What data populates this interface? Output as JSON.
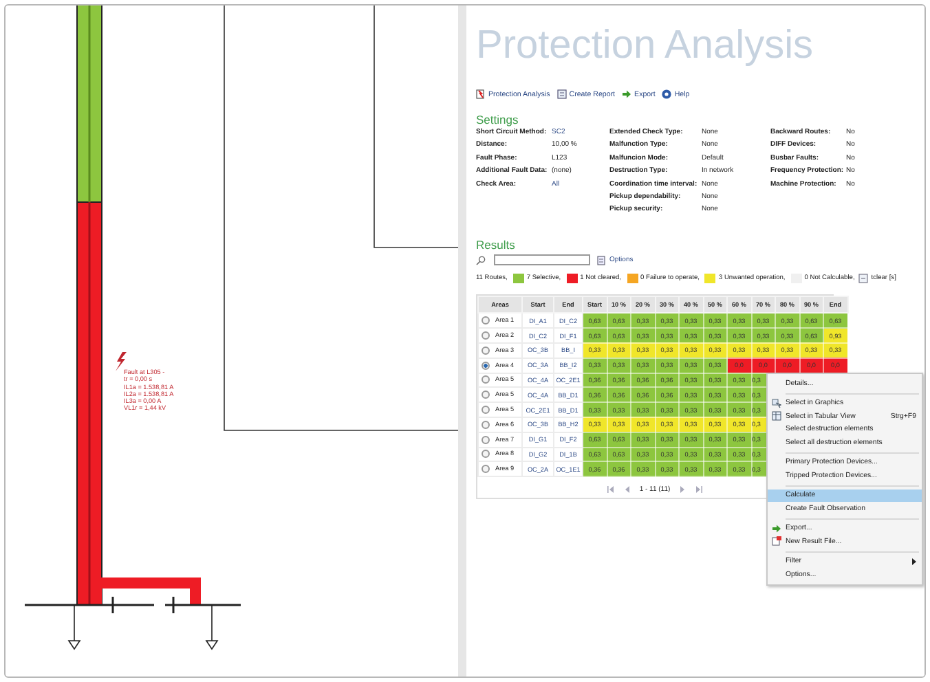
{
  "diagram": {
    "fault_label": [
      "Fault at L305 -",
      "tr = 0,00 s",
      "IL1a = 1.538,81 A",
      "IL2a = 1.538,81 A",
      "IL3a = 0,00 A",
      "VL1r = 1,44 kV"
    ]
  },
  "panel": {
    "title": "Protection Analysis",
    "toolbar": [
      {
        "label": "Protection Analysis",
        "kind": "analysis"
      },
      {
        "label": "Create Report",
        "kind": "report"
      },
      {
        "label": "Export",
        "kind": "export"
      },
      {
        "label": "Help",
        "kind": "help"
      }
    ],
    "settings_heading": "Settings",
    "settings": [
      [
        {
          "label": "Short Circuit Method:",
          "value": "SC2",
          "link": true
        },
        {
          "label": "Distance:",
          "value": "10,00 %",
          "link": false
        },
        {
          "label": "Fault Phase:",
          "value": "L123",
          "link": false
        },
        {
          "label": "Additional Fault Data:",
          "value": "(none)",
          "link": false
        },
        {
          "label": "Check Area:",
          "value": "All",
          "link": true
        }
      ],
      [
        {
          "label": "Extended Check Type:",
          "value": "None",
          "link": false
        },
        {
          "label": "Malfunction Type:",
          "value": "None",
          "link": false
        },
        {
          "label": "Malfuncion Mode:",
          "value": "Default",
          "link": false
        },
        {
          "label": "Destruction Type:",
          "value": "In network",
          "link": false
        },
        {
          "label": "Coordination time interval:",
          "value": "None",
          "link": false
        },
        {
          "label": "Pickup dependability:",
          "value": "None",
          "link": false
        },
        {
          "label": "Pickup security:",
          "value": "None",
          "link": false
        }
      ],
      [
        {
          "label": "Backward Routes:",
          "value": "No",
          "link": false
        },
        {
          "label": "DIFF Devices:",
          "value": "No",
          "link": false
        },
        {
          "label": "Busbar Faults:",
          "value": "No",
          "link": false
        },
        {
          "label": "Frequency Protection:",
          "value": "No",
          "link": false
        },
        {
          "label": "Machine Protection:",
          "value": "No",
          "link": false
        }
      ]
    ],
    "results_heading": "Results",
    "options_link": "Options",
    "legend": [
      {
        "text": "11 Routes,",
        "kind": "none"
      },
      {
        "text": "7 Selective,",
        "kind": "selective"
      },
      {
        "text": "1 Not cleared,",
        "kind": "notcleared"
      },
      {
        "text": "0 Failure to operate,",
        "kind": "failure"
      },
      {
        "text": "3 Unwanted operation,",
        "kind": "unwanted"
      },
      {
        "text": "0 Not Calculable,",
        "kind": "notcalc"
      },
      {
        "text": "tclear [s]",
        "kind": "tclear"
      }
    ],
    "table": {
      "columns": [
        "Areas",
        "Start",
        "End",
        "Start",
        "10 %",
        "20 %",
        "30 %",
        "40 %",
        "50 %",
        "60 %",
        "70 %",
        "80 %",
        "90 %",
        "End"
      ],
      "rows": [
        {
          "selected": false,
          "cells": [
            {
              "value": "Area 1",
              "kind": "area"
            },
            {
              "value": "DI_A1",
              "kind": "link"
            },
            {
              "value": "DI_C2",
              "kind": "link"
            },
            {
              "value": "0,63",
              "kind": "selective"
            },
            {
              "value": "0,63",
              "kind": "selective"
            },
            {
              "value": "0,33",
              "kind": "selective"
            },
            {
              "value": "0,33",
              "kind": "selective"
            },
            {
              "value": "0,33",
              "kind": "selective"
            },
            {
              "value": "0,33",
              "kind": "selective"
            },
            {
              "value": "0,33",
              "kind": "selective"
            },
            {
              "value": "0,33",
              "kind": "selective"
            },
            {
              "value": "0,33",
              "kind": "selective"
            },
            {
              "value": "0,63",
              "kind": "selective"
            },
            {
              "value": "0,63",
              "kind": "selective"
            }
          ]
        },
        {
          "selected": false,
          "cells": [
            {
              "value": "Area 2",
              "kind": "area"
            },
            {
              "value": "DI_C2",
              "kind": "link"
            },
            {
              "value": "DI_F1",
              "kind": "link"
            },
            {
              "value": "0,63",
              "kind": "selective"
            },
            {
              "value": "0,63",
              "kind": "selective"
            },
            {
              "value": "0,33",
              "kind": "selective"
            },
            {
              "value": "0,33",
              "kind": "selective"
            },
            {
              "value": "0,33",
              "kind": "selective"
            },
            {
              "value": "0,33",
              "kind": "selective"
            },
            {
              "value": "0,33",
              "kind": "selective"
            },
            {
              "value": "0,33",
              "kind": "selective"
            },
            {
              "value": "0,33",
              "kind": "selective"
            },
            {
              "value": "0,63",
              "kind": "selective"
            },
            {
              "value": "0,93",
              "kind": "unwanted"
            }
          ]
        },
        {
          "selected": false,
          "cells": [
            {
              "value": "Area 3",
              "kind": "area"
            },
            {
              "value": "OC_3B",
              "kind": "link"
            },
            {
              "value": "BB_I",
              "kind": "link"
            },
            {
              "value": "0,33",
              "kind": "unwanted"
            },
            {
              "value": "0,33",
              "kind": "unwanted"
            },
            {
              "value": "0,33",
              "kind": "unwanted"
            },
            {
              "value": "0,33",
              "kind": "unwanted"
            },
            {
              "value": "0,33",
              "kind": "unwanted"
            },
            {
              "value": "0,33",
              "kind": "unwanted"
            },
            {
              "value": "0,33",
              "kind": "unwanted"
            },
            {
              "value": "0,33",
              "kind": "unwanted"
            },
            {
              "value": "0,33",
              "kind": "unwanted"
            },
            {
              "value": "0,33",
              "kind": "unwanted"
            },
            {
              "value": "0,33",
              "kind": "unwanted"
            }
          ]
        },
        {
          "selected": true,
          "cells": [
            {
              "value": "Area 4",
              "kind": "area"
            },
            {
              "value": "OC_3A",
              "kind": "link"
            },
            {
              "value": "BB_I2",
              "kind": "link"
            },
            {
              "value": "0,33",
              "kind": "selective"
            },
            {
              "value": "0,33",
              "kind": "selective"
            },
            {
              "value": "0,33",
              "kind": "selective"
            },
            {
              "value": "0,33",
              "kind": "selective"
            },
            {
              "value": "0,33",
              "kind": "selective"
            },
            {
              "value": "0,33",
              "kind": "selective"
            },
            {
              "value": "0,0",
              "kind": "notcleared"
            },
            {
              "value": "0,0",
              "kind": "notcleared"
            },
            {
              "value": "0,0",
              "kind": "notcleared"
            },
            {
              "value": "0,0",
              "kind": "notcleared"
            },
            {
              "value": "0,0",
              "kind": "notcleared"
            }
          ]
        },
        {
          "selected": false,
          "cells": [
            {
              "value": "Area 5",
              "kind": "area"
            },
            {
              "value": "OC_4A",
              "kind": "link"
            },
            {
              "value": "OC_2E1",
              "kind": "link"
            },
            {
              "value": "0,36",
              "kind": "selective"
            },
            {
              "value": "0,36",
              "kind": "selective"
            },
            {
              "value": "0,36",
              "kind": "selective"
            },
            {
              "value": "0,36",
              "kind": "selective"
            },
            {
              "value": "0,33",
              "kind": "selective"
            },
            {
              "value": "0,33",
              "kind": "selective"
            },
            {
              "value": "0,33",
              "kind": "selective"
            },
            {
              "value": "0,3",
              "kind": "selective"
            }
          ]
        },
        {
          "selected": false,
          "cells": [
            {
              "value": "Area 5",
              "kind": "area"
            },
            {
              "value": "OC_4A",
              "kind": "link"
            },
            {
              "value": "BB_D1",
              "kind": "link"
            },
            {
              "value": "0,36",
              "kind": "selective"
            },
            {
              "value": "0,36",
              "kind": "selective"
            },
            {
              "value": "0,36",
              "kind": "selective"
            },
            {
              "value": "0,36",
              "kind": "selective"
            },
            {
              "value": "0,33",
              "kind": "selective"
            },
            {
              "value": "0,33",
              "kind": "selective"
            },
            {
              "value": "0,33",
              "kind": "selective"
            },
            {
              "value": "0,3",
              "kind": "selective"
            }
          ]
        },
        {
          "selected": false,
          "cells": [
            {
              "value": "Area 5",
              "kind": "area"
            },
            {
              "value": "OC_2E1",
              "kind": "link"
            },
            {
              "value": "BB_D1",
              "kind": "link"
            },
            {
              "value": "0,33",
              "kind": "selective"
            },
            {
              "value": "0,33",
              "kind": "selective"
            },
            {
              "value": "0,33",
              "kind": "selective"
            },
            {
              "value": "0,33",
              "kind": "selective"
            },
            {
              "value": "0,33",
              "kind": "selective"
            },
            {
              "value": "0,33",
              "kind": "selective"
            },
            {
              "value": "0,33",
              "kind": "selective"
            },
            {
              "value": "0,3",
              "kind": "selective"
            }
          ]
        },
        {
          "selected": false,
          "cells": [
            {
              "value": "Area 6",
              "kind": "area"
            },
            {
              "value": "OC_3B",
              "kind": "link"
            },
            {
              "value": "BB_H2",
              "kind": "link"
            },
            {
              "value": "0,33",
              "kind": "unwanted"
            },
            {
              "value": "0,33",
              "kind": "unwanted"
            },
            {
              "value": "0,33",
              "kind": "unwanted"
            },
            {
              "value": "0,33",
              "kind": "unwanted"
            },
            {
              "value": "0,33",
              "kind": "unwanted"
            },
            {
              "value": "0,33",
              "kind": "unwanted"
            },
            {
              "value": "0,33",
              "kind": "unwanted"
            },
            {
              "value": "0,3",
              "kind": "unwanted"
            }
          ]
        },
        {
          "selected": false,
          "cells": [
            {
              "value": "Area 7",
              "kind": "area"
            },
            {
              "value": "DI_G1",
              "kind": "link"
            },
            {
              "value": "DI_F2",
              "kind": "link"
            },
            {
              "value": "0,63",
              "kind": "selective"
            },
            {
              "value": "0,63",
              "kind": "selective"
            },
            {
              "value": "0,33",
              "kind": "selective"
            },
            {
              "value": "0,33",
              "kind": "selective"
            },
            {
              "value": "0,33",
              "kind": "selective"
            },
            {
              "value": "0,33",
              "kind": "selective"
            },
            {
              "value": "0,33",
              "kind": "selective"
            },
            {
              "value": "0,3",
              "kind": "selective"
            }
          ]
        },
        {
          "selected": false,
          "cells": [
            {
              "value": "Area 8",
              "kind": "area"
            },
            {
              "value": "DI_G2",
              "kind": "link"
            },
            {
              "value": "DI_1B",
              "kind": "link"
            },
            {
              "value": "0,63",
              "kind": "selective"
            },
            {
              "value": "0,63",
              "kind": "selective"
            },
            {
              "value": "0,33",
              "kind": "selective"
            },
            {
              "value": "0,33",
              "kind": "selective"
            },
            {
              "value": "0,33",
              "kind": "selective"
            },
            {
              "value": "0,33",
              "kind": "selective"
            },
            {
              "value": "0,33",
              "kind": "selective"
            },
            {
              "value": "0,3",
              "kind": "selective"
            }
          ]
        },
        {
          "selected": false,
          "cells": [
            {
              "value": "Area 9",
              "kind": "area"
            },
            {
              "value": "OC_2A",
              "kind": "link"
            },
            {
              "value": "OC_1E1",
              "kind": "link"
            },
            {
              "value": "0,36",
              "kind": "selective"
            },
            {
              "value": "0,36",
              "kind": "selective"
            },
            {
              "value": "0,33",
              "kind": "selective"
            },
            {
              "value": "0,33",
              "kind": "selective"
            },
            {
              "value": "0,33",
              "kind": "selective"
            },
            {
              "value": "0,33",
              "kind": "selective"
            },
            {
              "value": "0,33",
              "kind": "selective"
            },
            {
              "value": "0,3",
              "kind": "selective"
            }
          ]
        }
      ],
      "pager": "1 - 11 (11)"
    }
  },
  "context_menu": {
    "groups": [
      [
        {
          "label": "Details...",
          "kind": "plain",
          "selected": false
        }
      ],
      [
        {
          "label": "Select in Graphics",
          "kind": "graphics",
          "selected": false
        },
        {
          "label": "Select in Tabular View",
          "kind": "tabular",
          "shortcut": "Strg+F9",
          "selected": false
        },
        {
          "label": "Select destruction elements",
          "kind": "plain",
          "selected": false
        },
        {
          "label": "Select all destruction elements",
          "kind": "plain",
          "selected": false
        }
      ],
      [
        {
          "label": "Primary Protection Devices...",
          "kind": "plain",
          "selected": false
        },
        {
          "label": "Tripped Protection Devices...",
          "kind": "plain",
          "selected": false
        }
      ],
      [
        {
          "label": "Calculate",
          "kind": "plain",
          "selected": true
        },
        {
          "label": "Create Fault Observation",
          "kind": "plain",
          "selected": false
        }
      ],
      [
        {
          "label": "Export...",
          "kind": "export",
          "selected": false
        },
        {
          "label": "New Result File...",
          "kind": "newfile",
          "selected": false
        }
      ],
      [
        {
          "label": "Filter",
          "kind": "submenu",
          "selected": false
        },
        {
          "label": "Options...",
          "kind": "plain",
          "selected": false
        }
      ]
    ]
  }
}
